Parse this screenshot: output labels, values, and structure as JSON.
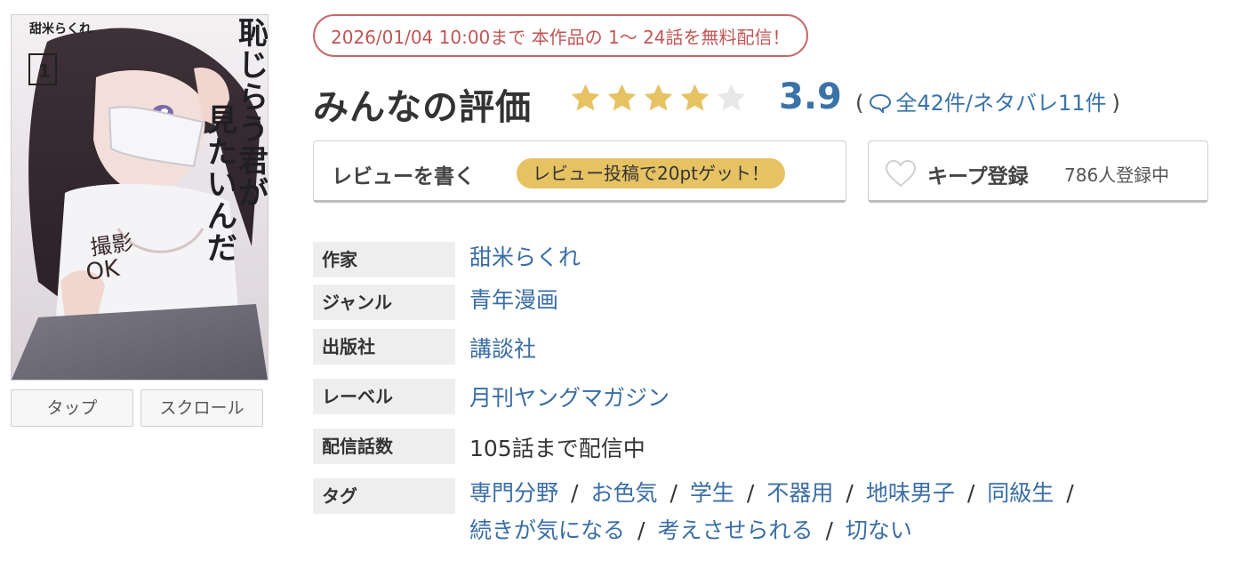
{
  "cover": {
    "author_text": "甜米らくれ",
    "volume": "1",
    "title_text": "恥じらう君が見たいんだ",
    "overlay_text": "撮影OK",
    "buttons": {
      "tap": "タップ",
      "scroll": "スクロール"
    }
  },
  "free_banner": "2026/01/04 10:00まで 本作品の 1〜 24話を無料配信！",
  "rating": {
    "title": "みんなの評価",
    "value": "3.9",
    "stars": 3.9,
    "open_paren": "(",
    "close_paren": ")",
    "counts": "全42件/ネタバレ11件",
    "star_color": "#e6c263",
    "value_color": "#3a73a8"
  },
  "review_button": {
    "label": "レビューを書く",
    "promo": "レビュー投稿で20ptゲット！"
  },
  "keep_button": {
    "label": "キープ登録",
    "count": "786人登録中"
  },
  "info": {
    "author": {
      "label": "作家",
      "value": "甜米らくれ"
    },
    "genre": {
      "label": "ジャンル",
      "value": "青年漫画"
    },
    "publisher": {
      "label": "出版社",
      "value": "講談社"
    },
    "label": {
      "label": "レーベル",
      "value": "月刊ヤングマガジン"
    },
    "episodes": {
      "label": "配信話数",
      "value": "105話まで配信中"
    },
    "tags": {
      "label": "タグ",
      "items": [
        "専門分野",
        "お色気",
        "学生",
        "不器用",
        "地味男子",
        "同級生",
        "続きが気になる",
        "考えさせられる",
        "切ない"
      ],
      "separator": "/"
    }
  }
}
